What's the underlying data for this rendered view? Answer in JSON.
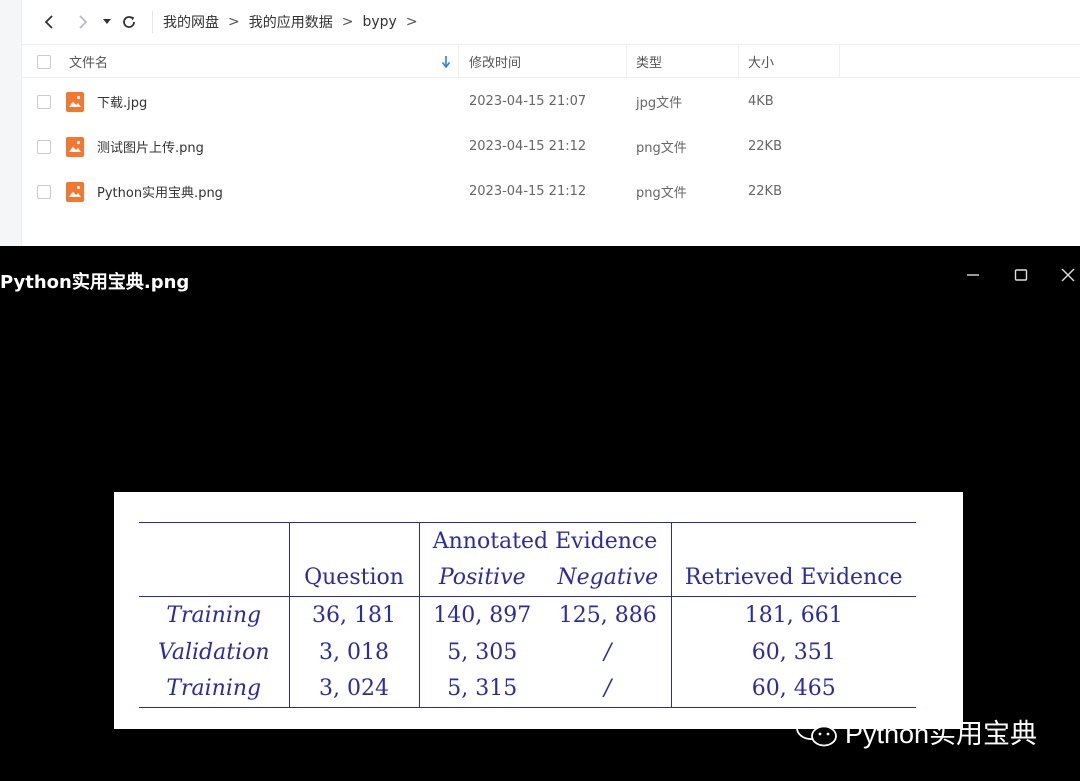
{
  "toolbar": {
    "back_icon": "chevron-left-icon",
    "forward_icon": "chevron-right-icon",
    "history_icon": "caret-down-icon",
    "refresh_icon": "refresh-icon"
  },
  "breadcrumb": [
    "我的网盘",
    "我的应用数据",
    "bypy"
  ],
  "breadcrumb_separator": ">",
  "columns": {
    "name": "文件名",
    "modified": "修改时间",
    "type": "类型",
    "size": "大小",
    "sort_icon": "sort-down-arrow-icon"
  },
  "files": [
    {
      "name": "下载.jpg",
      "modified": "2023-04-15 21:07",
      "type": "jpg文件",
      "size": "4KB",
      "icon": "image-file-icon"
    },
    {
      "name": "测试图片上传.png",
      "modified": "2023-04-15 21:12",
      "type": "png文件",
      "size": "22KB",
      "icon": "image-file-icon"
    },
    {
      "name": "Python实用宝典.png",
      "modified": "2023-04-15 21:12",
      "type": "png文件",
      "size": "22KB",
      "icon": "image-file-icon"
    }
  ],
  "viewer": {
    "title": "Python实用宝典.png",
    "controls": [
      "minimize-icon",
      "maximize-icon",
      "close-icon"
    ]
  },
  "photo_table": {
    "headers": {
      "group": "Annotated Evidence",
      "question": "Question",
      "positive": "Positive",
      "negative": "Negative",
      "retrieved": "Retrieved Evidence"
    },
    "rows": [
      {
        "split": "Training",
        "question": "36, 181",
        "positive": "140, 897",
        "negative": "125, 886",
        "retrieved": "181, 661"
      },
      {
        "split": "Validation",
        "question": "3, 018",
        "positive": "5, 305",
        "negative": "/",
        "retrieved": "60, 351"
      },
      {
        "split": "Training",
        "question": "3, 024",
        "positive": "5, 315",
        "negative": "/",
        "retrieved": "60, 465"
      }
    ]
  },
  "watermark": {
    "text": "Python实用宝典",
    "icon": "wechat-icon"
  },
  "colors": {
    "file_icon": "#f5762e",
    "table_ink": "#2a2ab0",
    "sort_arrow": "#1e88e5"
  }
}
